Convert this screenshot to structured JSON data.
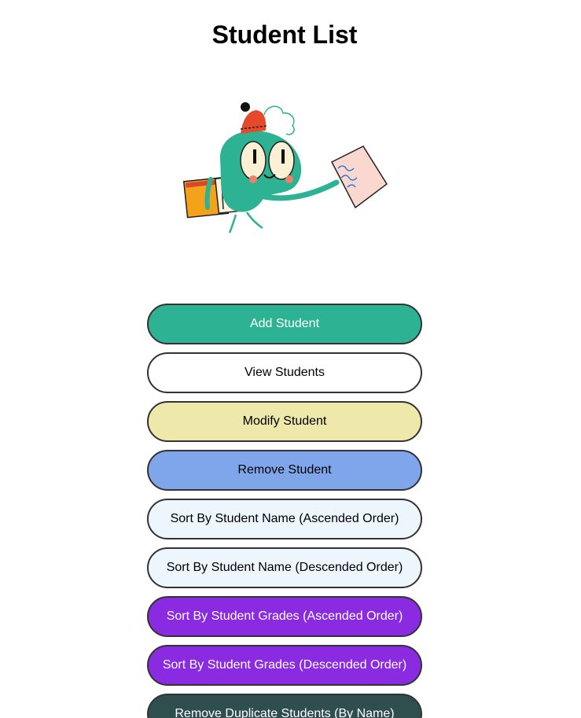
{
  "page": {
    "title": "Student List"
  },
  "illustration": {
    "icon": "student-carrying-books-illustration",
    "paper_text": "A"
  },
  "buttons": [
    {
      "label": "Add Student",
      "bg": "#2db394",
      "fg": "#ffffff"
    },
    {
      "label": "View Students",
      "bg": "#ffffff",
      "fg": "#000000"
    },
    {
      "label": "Modify Student",
      "bg": "#eee8aa",
      "fg": "#000000"
    },
    {
      "label": "Remove Student",
      "bg": "#7fa6ea",
      "fg": "#000000"
    },
    {
      "label": "Sort By Student Name (Ascended Order)",
      "bg": "#eef6fd",
      "fg": "#000000"
    },
    {
      "label": "Sort By Student Name (Descended Order)",
      "bg": "#eef6fd",
      "fg": "#000000"
    },
    {
      "label": "Sort By Student Grades (Ascended Order)",
      "bg": "#8a2be2",
      "fg": "#ffffff"
    },
    {
      "label": "Sort By Student Grades (Descended Order)",
      "bg": "#8a2be2",
      "fg": "#ffffff"
    },
    {
      "label": "Remove Duplicate Students (By Name)",
      "bg": "#2f4f4f",
      "fg": "#ffffff"
    }
  ]
}
